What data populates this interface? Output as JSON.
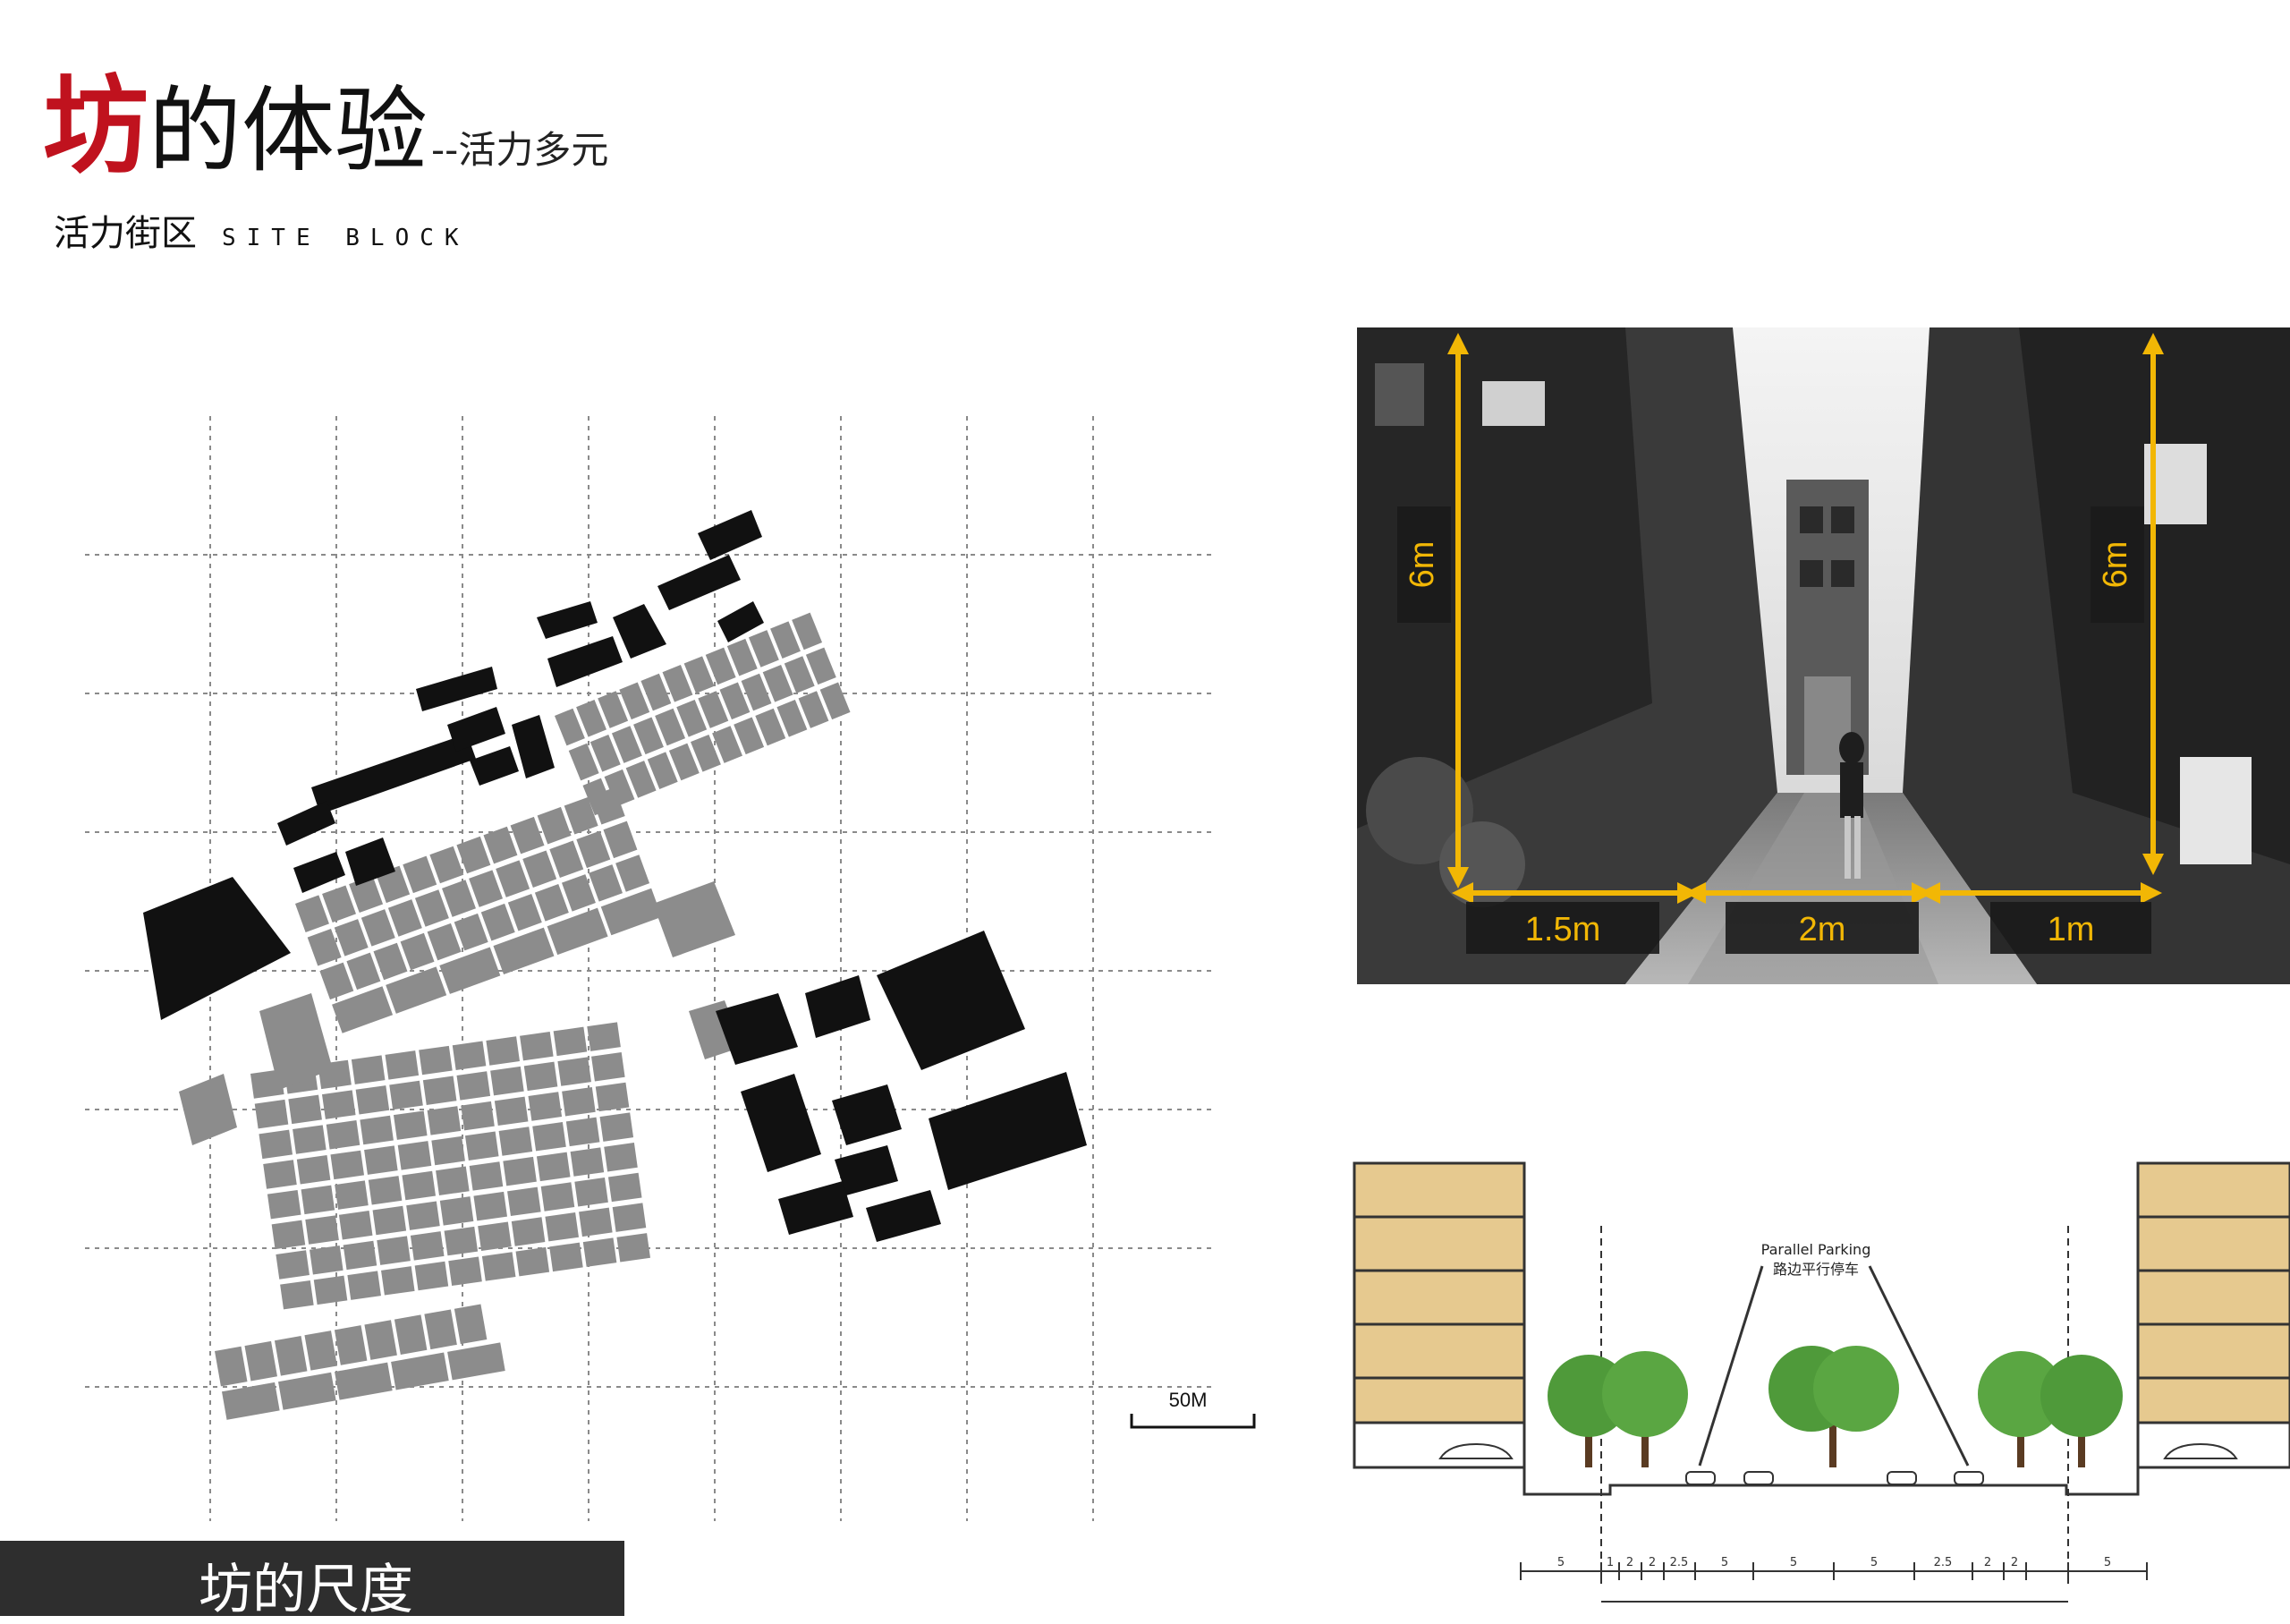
{
  "title": {
    "highlight_char": "坊",
    "main_text": "的体验",
    "sub_text": "--活力多元"
  },
  "subtitle": {
    "cn": "活力街区",
    "en": "SITE BLOCK"
  },
  "site_plan": {
    "scale_label": "50M",
    "caption": "坊的尺度"
  },
  "street_photo": {
    "height_left": "6m",
    "height_right": "6m",
    "width_labels": [
      "1.5m",
      "2m",
      "1m"
    ],
    "accent_color": "#f2b705"
  },
  "street_section": {
    "callout_en": "Parallel Parking",
    "callout_cn": "路边平行停车",
    "dim_labels": [
      "5",
      "1",
      "2",
      "2",
      "2.5",
      "5",
      "5",
      "5",
      "2.5",
      "2",
      "2",
      "5"
    ]
  }
}
